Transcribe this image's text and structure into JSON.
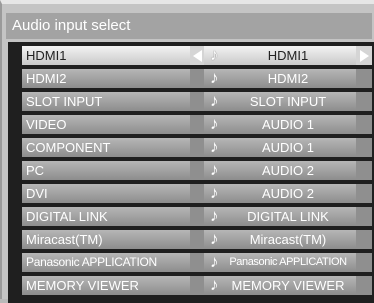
{
  "window": {
    "title": "Audio input select"
  },
  "rows": [
    {
      "input": "HDMI1",
      "audio": "HDMI1"
    },
    {
      "input": "HDMI2",
      "audio": "HDMI2"
    },
    {
      "input": "SLOT INPUT",
      "audio": "SLOT INPUT"
    },
    {
      "input": "VIDEO",
      "audio": "AUDIO 1"
    },
    {
      "input": "COMPONENT",
      "audio": "AUDIO 1"
    },
    {
      "input": "PC",
      "audio": "AUDIO 2"
    },
    {
      "input": "DVI",
      "audio": "AUDIO 2"
    },
    {
      "input": "DIGITAL LINK",
      "audio": "DIGITAL LINK"
    },
    {
      "input": "Miracast(TM)",
      "audio": "Miracast(TM)"
    },
    {
      "input": "Panasonic APPLICATION",
      "audio": "Panasonic APPLICATION"
    },
    {
      "input": "MEMORY VIEWER",
      "audio": "MEMORY VIEWER"
    }
  ],
  "icons": {
    "audio": "music-note-icon",
    "left": "left-arrow-icon",
    "right": "right-arrow-icon"
  },
  "colors": {
    "selected_row": "#e6e6e6",
    "row": "#9f9f9f",
    "text": "#ffffff"
  }
}
